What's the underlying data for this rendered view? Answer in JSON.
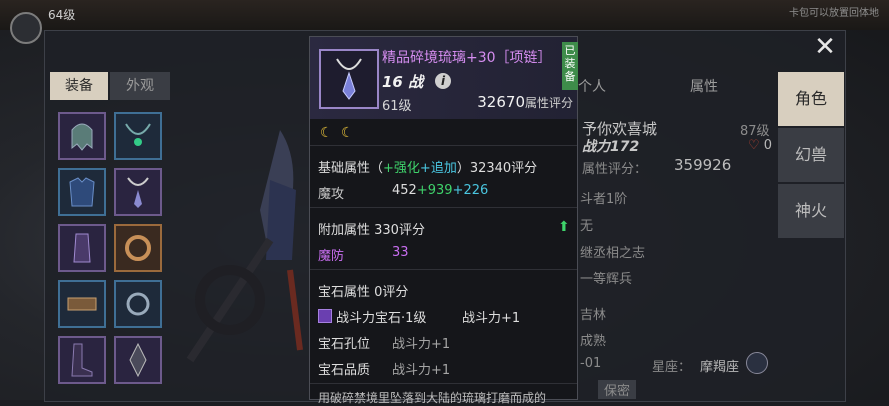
{
  "topbar": {
    "level": "64级",
    "right_text": "卡包可以放置回体地"
  },
  "tabs": {
    "equip": "装备",
    "look": "外观"
  },
  "right_tabs": {
    "role": "角色",
    "beast": "幻兽",
    "fire": "神火"
  },
  "info_tabs": {
    "person": "个人",
    "attr": "属性"
  },
  "char_info": {
    "name": "予你欢喜城",
    "level_label": "87级",
    "power": "战力172",
    "score_label": "属性评分：",
    "score": "359926",
    "heart_count": "0",
    "line1": "斗者1阶",
    "line2": "无",
    "line3": "继丞相之志",
    "line4": "一等辉兵",
    "line5": "吉林",
    "line6": "成熟",
    "line7": "-01",
    "star_label": "星座：",
    "star_value": "摩羯座",
    "secret": "保密"
  },
  "tooltip": {
    "name": "精品碎境琉璃+30［项链］",
    "equipped": "已装备",
    "power": "16 战",
    "level": "61级",
    "score": "32670",
    "score_unit": "属性评分",
    "base_title_a": "基础属性（",
    "base_title_b": "+强化",
    "base_title_c": "+追加",
    "base_title_d": "）32340评分",
    "matk_label": "魔攻",
    "matk_base": "452",
    "matk_plus1": "+939",
    "matk_plus2": "+226",
    "extra_title": "附加属性 330评分",
    "mdef_label": "魔防",
    "mdef_value": "33",
    "gem_title": "宝石属性 0评分",
    "gem_name": "战斗力宝石·1级",
    "gem_effect": "战斗力+1",
    "gem_hole_label": "宝石孔位",
    "gem_hole_value": "战斗力+1",
    "gem_quality_label": "宝石品质",
    "gem_quality_value": "战斗力+1",
    "bottom_text": "用破碎禁境里坠落到大陆的琉璃打磨而成的"
  },
  "colors": {
    "accent_purple": "#d58df0",
    "green": "#3fd36b",
    "cyan": "#4ac6e0",
    "tab_active": "#d8cfbf"
  }
}
